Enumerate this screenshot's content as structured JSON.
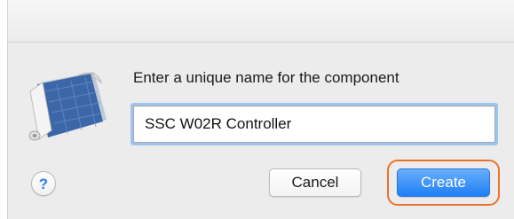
{
  "dialog": {
    "prompt": "Enter a unique name for the component",
    "name_value": "SSC W02R Controller",
    "icon": "blueprint-document-icon",
    "help_label": "?",
    "cancel_label": "Cancel",
    "create_label": "Create"
  },
  "colors": {
    "accent": "#1e7ff4",
    "highlight": "#e8732c",
    "dialog_bg": "#ececec"
  }
}
